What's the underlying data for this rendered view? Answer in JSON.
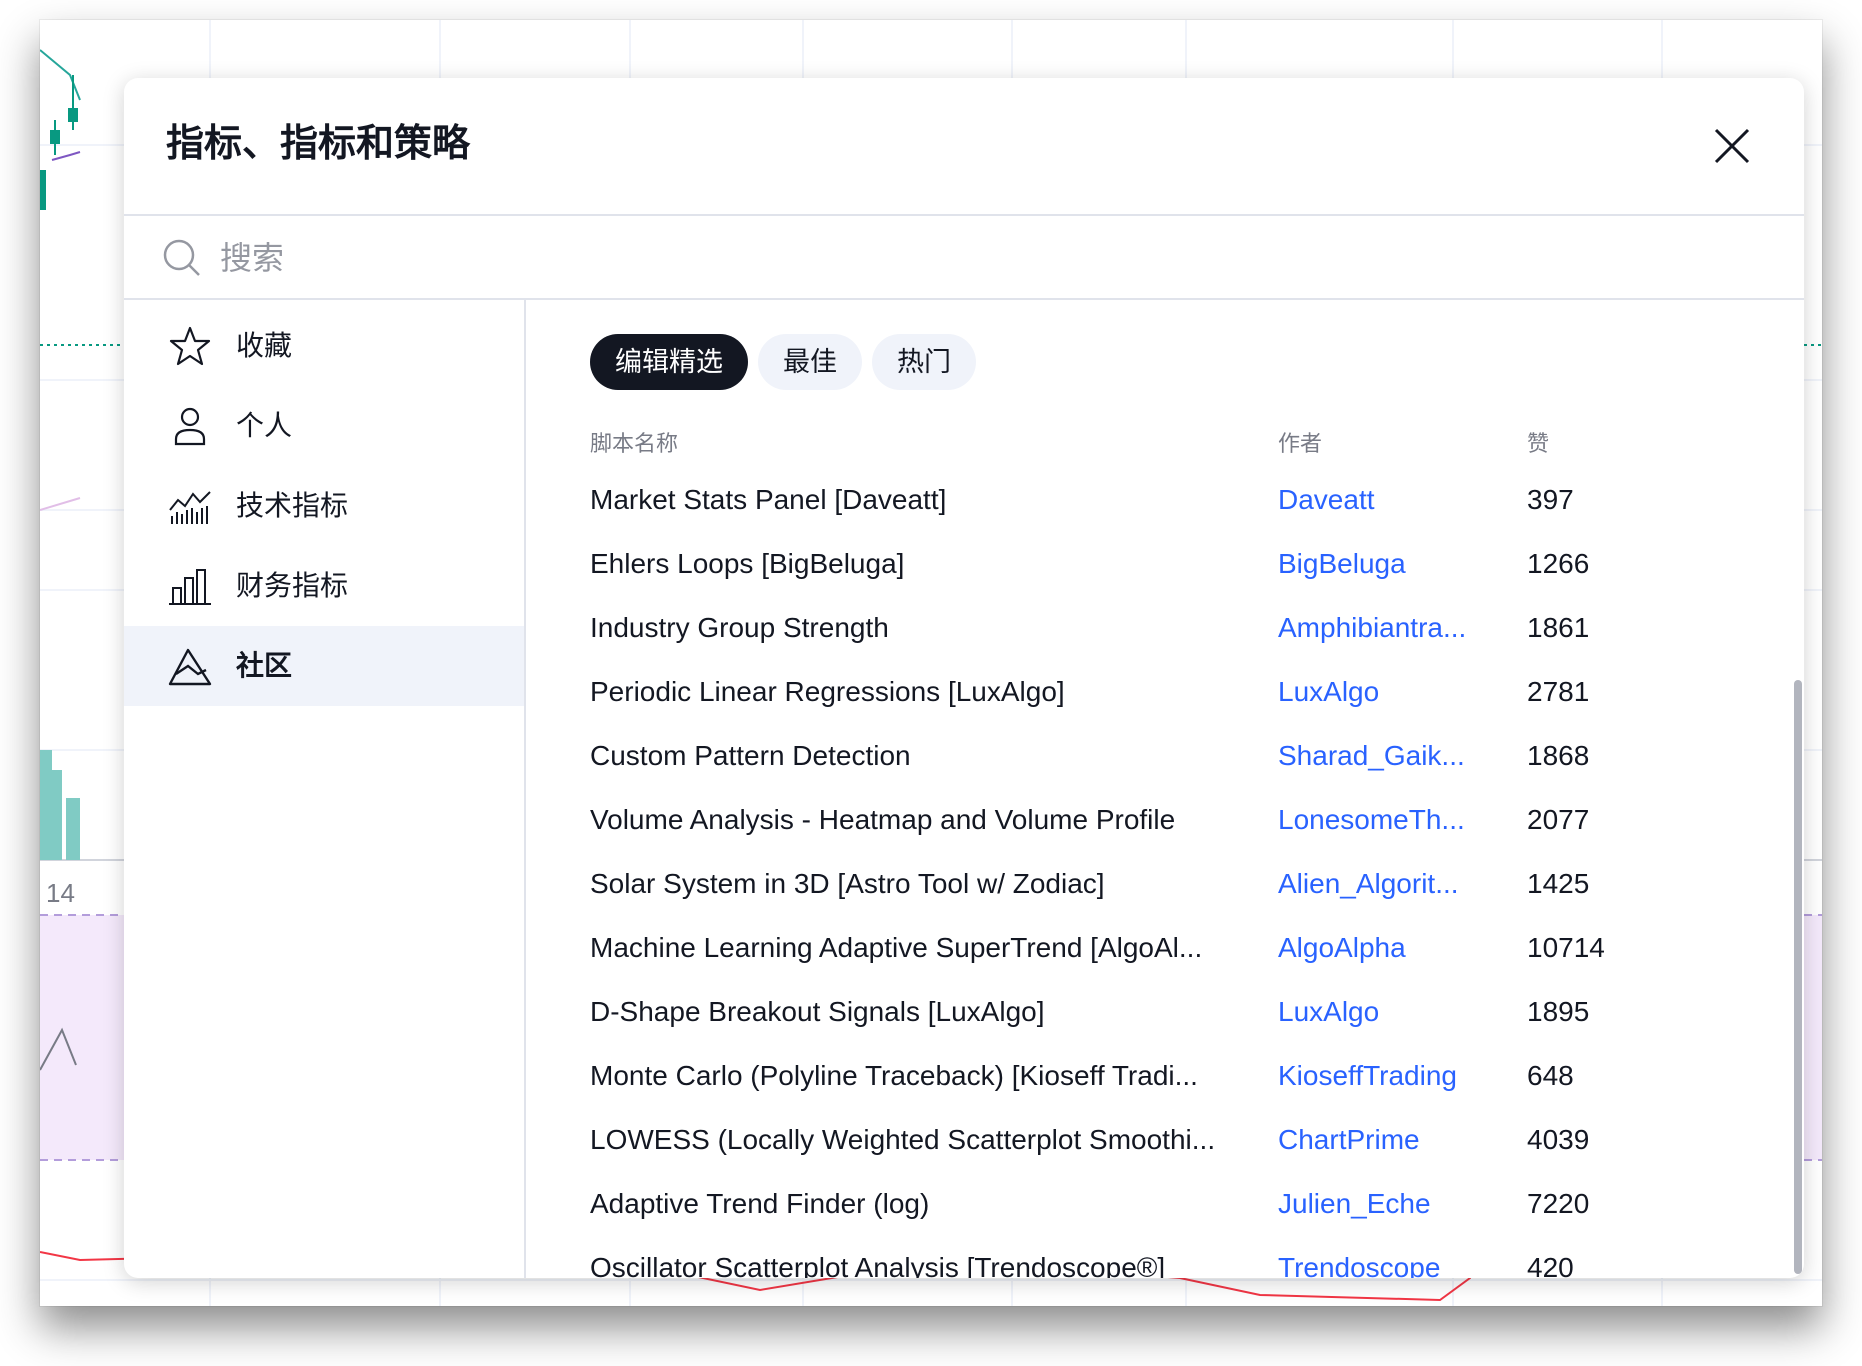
{
  "dialog": {
    "title": "指标、指标和策略",
    "close_icon": "close-icon"
  },
  "search": {
    "placeholder": "搜索",
    "value": ""
  },
  "sidebar": {
    "items": [
      {
        "label": "收藏",
        "icon": "star-icon"
      },
      {
        "label": "个人",
        "icon": "user-icon"
      },
      {
        "label": "技术指标",
        "icon": "technical-chart-icon"
      },
      {
        "label": "财务指标",
        "icon": "bar-chart-icon"
      },
      {
        "label": "社区",
        "icon": "community-mountain-icon",
        "active": true
      }
    ]
  },
  "tabs": [
    {
      "label": "编辑精选",
      "active": true
    },
    {
      "label": "最佳"
    },
    {
      "label": "热门"
    }
  ],
  "table": {
    "headers": {
      "name": "脚本名称",
      "author": "作者",
      "likes": "赞"
    },
    "rows": [
      {
        "name": "Market Stats Panel [Daveatt]",
        "author": "Daveatt",
        "likes": "397"
      },
      {
        "name": "Ehlers Loops [BigBeluga]",
        "author": "BigBeluga",
        "likes": "1266"
      },
      {
        "name": "Industry Group Strength",
        "author": "Amphibiantra...",
        "likes": "1861"
      },
      {
        "name": "Periodic Linear Regressions [LuxAlgo]",
        "author": "LuxAlgo",
        "likes": "2781"
      },
      {
        "name": "Custom Pattern Detection",
        "author": "Sharad_Gaik...",
        "likes": "1868"
      },
      {
        "name": "Volume Analysis - Heatmap and Volume Profile",
        "author": "LonesomeTh...",
        "likes": "2077"
      },
      {
        "name": "Solar System in 3D [Astro Tool w/ Zodiac]",
        "author": "Alien_Algorit...",
        "likes": "1425"
      },
      {
        "name": "Machine Learning Adaptive SuperTrend [AlgoAl...",
        "author": "AlgoAlpha",
        "likes": "10714"
      },
      {
        "name": "D-Shape Breakout Signals [LuxAlgo]",
        "author": "LuxAlgo",
        "likes": "1895"
      },
      {
        "name": "Monte Carlo (Polyline Traceback) [Kioseff Tradi...",
        "author": "KioseffTrading",
        "likes": "648"
      },
      {
        "name": "LOWESS (Locally Weighted Scatterplot Smoothi...",
        "author": "ChartPrime",
        "likes": "4039"
      },
      {
        "name": "Adaptive Trend Finder (log)",
        "author": "Julien_Eche",
        "likes": "7220"
      },
      {
        "name": "Oscillator Scatterplot Analysis [Trendoscope®]",
        "author": "Trendoscope",
        "likes": "420"
      }
    ]
  },
  "background_chart": {
    "axis_label": "14"
  },
  "colors": {
    "accent_link": "#2962ff",
    "tab_active_bg": "#131722",
    "sidebar_active_bg": "#f0f3fa",
    "text_primary": "#131722",
    "text_muted": "#787b86"
  }
}
